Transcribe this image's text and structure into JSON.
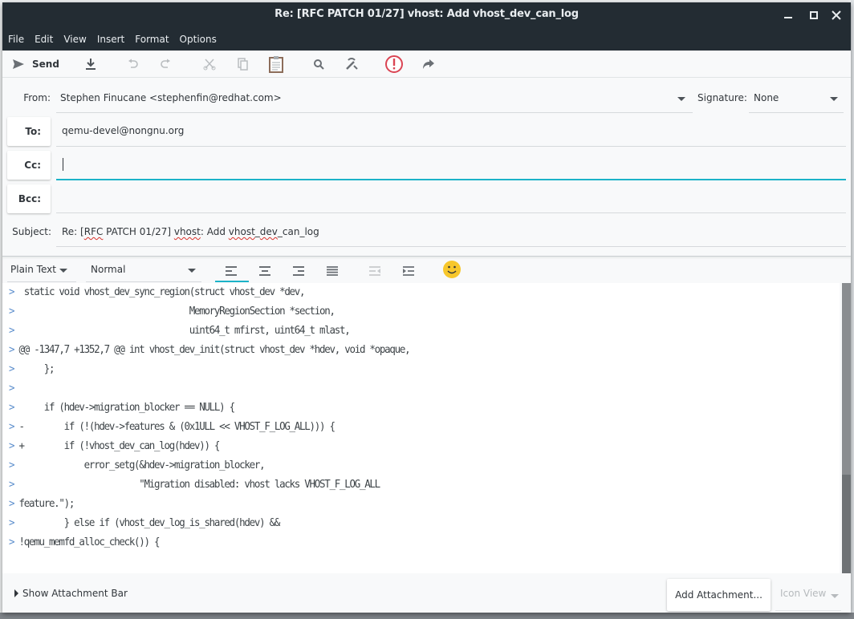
{
  "window": {
    "title": "Re: [RFC PATCH 01/27] vhost: Add vhost_dev_can_log",
    "controls": {
      "minimize": "minimize",
      "maximize": "maximize",
      "close": "close"
    }
  },
  "menu": [
    "File",
    "Edit",
    "View",
    "Insert",
    "Format",
    "Options"
  ],
  "toolbar": {
    "send_label": "Send",
    "icons": [
      "send-icon",
      "save-draft-icon",
      "undo-icon",
      "redo-icon",
      "cut-icon",
      "copy-icon",
      "paste-icon",
      "find-icon",
      "spellcheck-icon",
      "priority-icon",
      "forward-icon"
    ],
    "accent_colors": {
      "priority": "#da4453",
      "paste_border": "#8c6d5a",
      "focus": "#1cb3c8"
    }
  },
  "header": {
    "from_label": "From:",
    "from_value": "Stephen Finucane <stephenfin@redhat.com>",
    "signature_label": "Signature:",
    "signature_value": "None",
    "to_label": "To:",
    "to_value": "qemu-devel@nongnu.org",
    "cc_label": "Cc:",
    "cc_value": "",
    "bcc_label": "Bcc:",
    "bcc_value": "",
    "subject_label": "Subject:",
    "subject_parts": [
      "Re: [",
      "RFC",
      " PATCH 01/27] ",
      "vhost",
      ": Add ",
      "vhost",
      "_",
      "dev",
      "_can_log"
    ]
  },
  "format_bar": {
    "mode": "Plain Text",
    "paragraph_style": "Normal",
    "align_buttons": [
      "align-left-icon",
      "align-center-icon",
      "align-right-icon",
      "align-justify-icon",
      "unindent-icon",
      "indent-icon",
      "emoji-icon"
    ],
    "active_align": "left"
  },
  "body": {
    "lines": [
      {
        "q": ">",
        "t": "  static void vhost_dev_sync_region(struct vhost_dev *dev,"
      },
      {
        "q": ">",
        "t": "                                   MemoryRegionSection *section,"
      },
      {
        "q": ">",
        "t": "                                   uint64_t mfirst, uint64_t mlast,"
      },
      {
        "q": ">",
        "t": " @@ -1347,7 +1352,7 @@ int vhost_dev_init(struct vhost_dev *hdev, void *opaque,"
      },
      {
        "q": ">",
        "t": "      };"
      },
      {
        "q": ">",
        "t": ""
      },
      {
        "q": ">",
        "t": "      if (hdev->migration_blocker == NULL) {"
      },
      {
        "q": ">",
        "t": " -        if (!(hdev->features & (0x1ULL << VHOST_F_LOG_ALL))) {"
      },
      {
        "q": ">",
        "t": " +        if (!vhost_dev_can_log(hdev)) {"
      },
      {
        "q": ">",
        "t": "              error_setg(&hdev->migration_blocker,"
      },
      {
        "q": ">",
        "t": "                         \"Migration disabled: vhost lacks VHOST_F_LOG_ALL"
      },
      {
        "q": ">",
        "t": " feature.\");"
      },
      {
        "q": ">",
        "t": "          } else if (vhost_dev_log_is_shared(hdev) &&"
      },
      {
        "q": ">",
        "t": " !qemu_memfd_alloc_check()) {"
      }
    ]
  },
  "scrollbar": {
    "thumb_fraction": 0.66,
    "position": 0
  },
  "attachments": {
    "show_bar_label": "Show Attachment Bar",
    "add_label": "Add Attachment...",
    "view_mode": "Icon View"
  }
}
